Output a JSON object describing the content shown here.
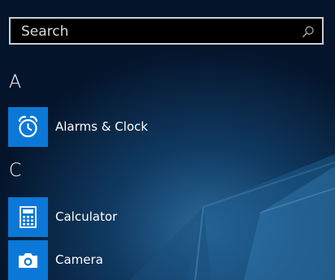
{
  "search": {
    "label": "Search",
    "icon": "search-icon"
  },
  "sections": [
    {
      "letter": "A",
      "apps": [
        {
          "label": "Alarms & Clock",
          "icon": "alarm-clock-icon"
        }
      ]
    },
    {
      "letter": "C",
      "apps": [
        {
          "label": "Calculator",
          "icon": "calculator-icon"
        },
        {
          "label": "Camera",
          "icon": "camera-icon"
        }
      ]
    }
  ],
  "colors": {
    "tile": "#0b78d7",
    "background": "#061830",
    "search_border": "#c8ccd4"
  }
}
